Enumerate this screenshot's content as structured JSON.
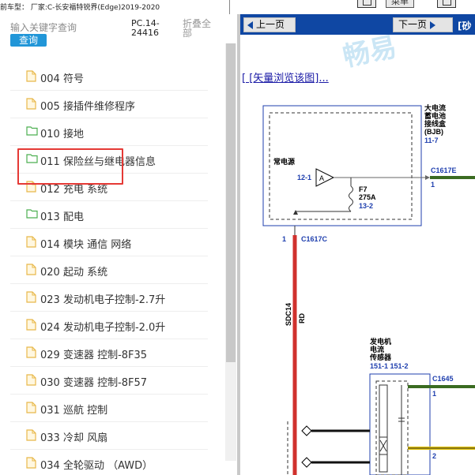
{
  "topbar": {
    "vehicle_label": "前车型： 厂家:C-长安福特锐界(Edge)2019-2020",
    "button_label": "菜单"
  },
  "left_panel": {
    "search_placeholder": "输入关键字查询",
    "search_button": "查询",
    "pc_code": "PC.14-24416",
    "collapse_all": "折叠全部",
    "tree_items": [
      {
        "label": "004 符号",
        "icon": "file-icon"
      },
      {
        "label": "005 接插件维修程序",
        "icon": "file-icon"
      },
      {
        "label": "010 接地",
        "icon": "folder-icon"
      },
      {
        "label": "011 保险丝与继电器信息",
        "icon": "folder-icon"
      },
      {
        "label": "012 充电 系统",
        "icon": "file-icon"
      },
      {
        "label": "013 配电",
        "icon": "folder-icon"
      },
      {
        "label": "014 模块 通信 网络",
        "icon": "file-icon"
      },
      {
        "label": "020 起动 系统",
        "icon": "file-icon"
      },
      {
        "label": "023 发动机电子控制-2.7升",
        "icon": "file-icon"
      },
      {
        "label": "024 发动机电子控制-2.0升",
        "icon": "file-icon"
      },
      {
        "label": "029 变速器 控制-8F35",
        "icon": "file-icon"
      },
      {
        "label": "030 变速器 控制-8F57",
        "icon": "file-icon"
      },
      {
        "label": "031 巡航 控制",
        "icon": "file-icon"
      },
      {
        "label": "033 冷却 风扇",
        "icon": "file-icon"
      },
      {
        "label": "034 全轮驱动 （AWD）",
        "icon": "file-icon"
      }
    ],
    "selected_index": 4
  },
  "right_panel": {
    "prev_button": "上一页",
    "next_button": "下一页",
    "right_edge_text": "[砂",
    "watermark": "畅易",
    "vector_link": "[ [矢量浏览该图]..."
  },
  "diagram": {
    "bjb_title": [
      "大电流",
      "蓄电池",
      "接线盒",
      "(BJB)"
    ],
    "bjb_ref": "11-7",
    "constant_power": "常电源",
    "pin_12_1": "12-1",
    "amp_label": "A",
    "fuse_name": "F7",
    "fuse_rating": "275A",
    "fuse_ref": "13-2",
    "conn_right": "C1617E",
    "conn_right_pin": "1",
    "conn_down_pin": "1",
    "conn_down": "C1617C",
    "wire_code": "SDC14",
    "wire_color": "RD",
    "sensor_title": [
      "发电机",
      "电流",
      "传感器"
    ],
    "sensor_pins": "151-1  151-2",
    "conn_c1645": "C1645",
    "c1645_pin1": "1",
    "c1645_pin2": "2"
  },
  "colors": {
    "nav_blue": "#0f47a3",
    "search_blue": "#2196d8",
    "highlight_red": "#e53935",
    "wire_red": "#d0312d",
    "wire_green": "#3a6b21",
    "wire_yellow": "#e0c000",
    "label_blue": "#1f3fae"
  }
}
